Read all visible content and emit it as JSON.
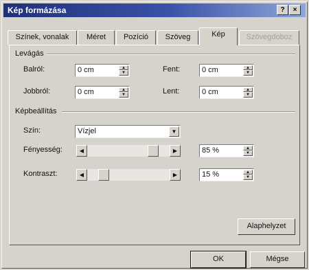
{
  "window": {
    "title": "Kép formázása",
    "help_glyph": "?",
    "close_glyph": "×"
  },
  "tabs": [
    {
      "label": "Színek, vonalak",
      "state": "normal"
    },
    {
      "label": "Méret",
      "state": "normal"
    },
    {
      "label": "Pozíció",
      "state": "normal"
    },
    {
      "label": "Szöveg",
      "state": "normal"
    },
    {
      "label": "Kép",
      "state": "active"
    },
    {
      "label": "Szövegdoboz",
      "state": "disabled"
    }
  ],
  "crop": {
    "heading": "Levágás",
    "left_label": "Balról:",
    "left_value": "0 cm",
    "right_label": "Jobbról:",
    "right_value": "0 cm",
    "top_label": "Fent:",
    "top_value": "0 cm",
    "bottom_label": "Lent:",
    "bottom_value": "0 cm"
  },
  "image_control": {
    "heading": "Képbeállítás",
    "color_label": "Szín:",
    "color_value": "Vízjel",
    "brightness_label": "Fényesség:",
    "brightness_value": "85 %",
    "brightness_level": 0.85,
    "contrast_label": "Kontraszt:",
    "contrast_value": "15 %",
    "contrast_level": 0.15
  },
  "buttons": {
    "reset": "Alaphelyzet",
    "ok": "OK",
    "cancel": "Mégse"
  },
  "colors": {
    "title_bar_start": "#20307a",
    "title_bar_end": "#8fa6d8",
    "face": "#d6d2cc"
  }
}
